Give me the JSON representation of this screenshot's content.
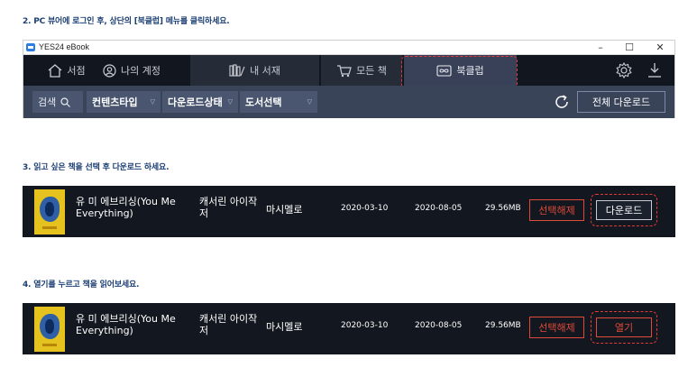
{
  "steps": {
    "step1": "2. PC 뷰어에 로그인 후, 상단의 [북클럽] 메뉴를 클릭하세요.",
    "step2": "3. 읽고 싶은 책을 선택 후 다운로드 하세요.",
    "step3": "4. 열기를 누르고 책을 읽어보세요."
  },
  "window": {
    "title": "YES24 eBook",
    "controls": {
      "minimize": "–",
      "maximize": "☐",
      "close": "✕"
    }
  },
  "nav": {
    "search": "서점",
    "account": "나의 계정",
    "library": "내 서재",
    "all_books": "모든 책",
    "bookclub": "북클럽"
  },
  "filters": {
    "search": "검색",
    "content_type": "컨텐츠타입",
    "download_state": "다운로드상태",
    "book_select": "도서선택",
    "download_all": "전체 다운로드"
  },
  "books": [
    {
      "title": "유 미 에브리싱(You Me Everything)",
      "author": "캐서린 아이작 저",
      "publisher": "마시멜로",
      "date1": "2020-03-10",
      "date2": "2020-08-05",
      "size": "29.56MB",
      "deselect": "선택해제",
      "action": "다운로드"
    },
    {
      "title": "유 미 에브리싱(You Me Everything)",
      "author": "캐서린 아이작 저",
      "publisher": "마시멜로",
      "date1": "2020-03-10",
      "date2": "2020-08-05",
      "size": "29.56MB",
      "deselect": "선택해제",
      "action": "열기"
    }
  ],
  "colors": {
    "step_text": "#1c3f74",
    "window_bg": "#1e2330",
    "filterbar_bg": "#3a4459",
    "highlight": "#e53935",
    "cover": "#e6c21e"
  }
}
